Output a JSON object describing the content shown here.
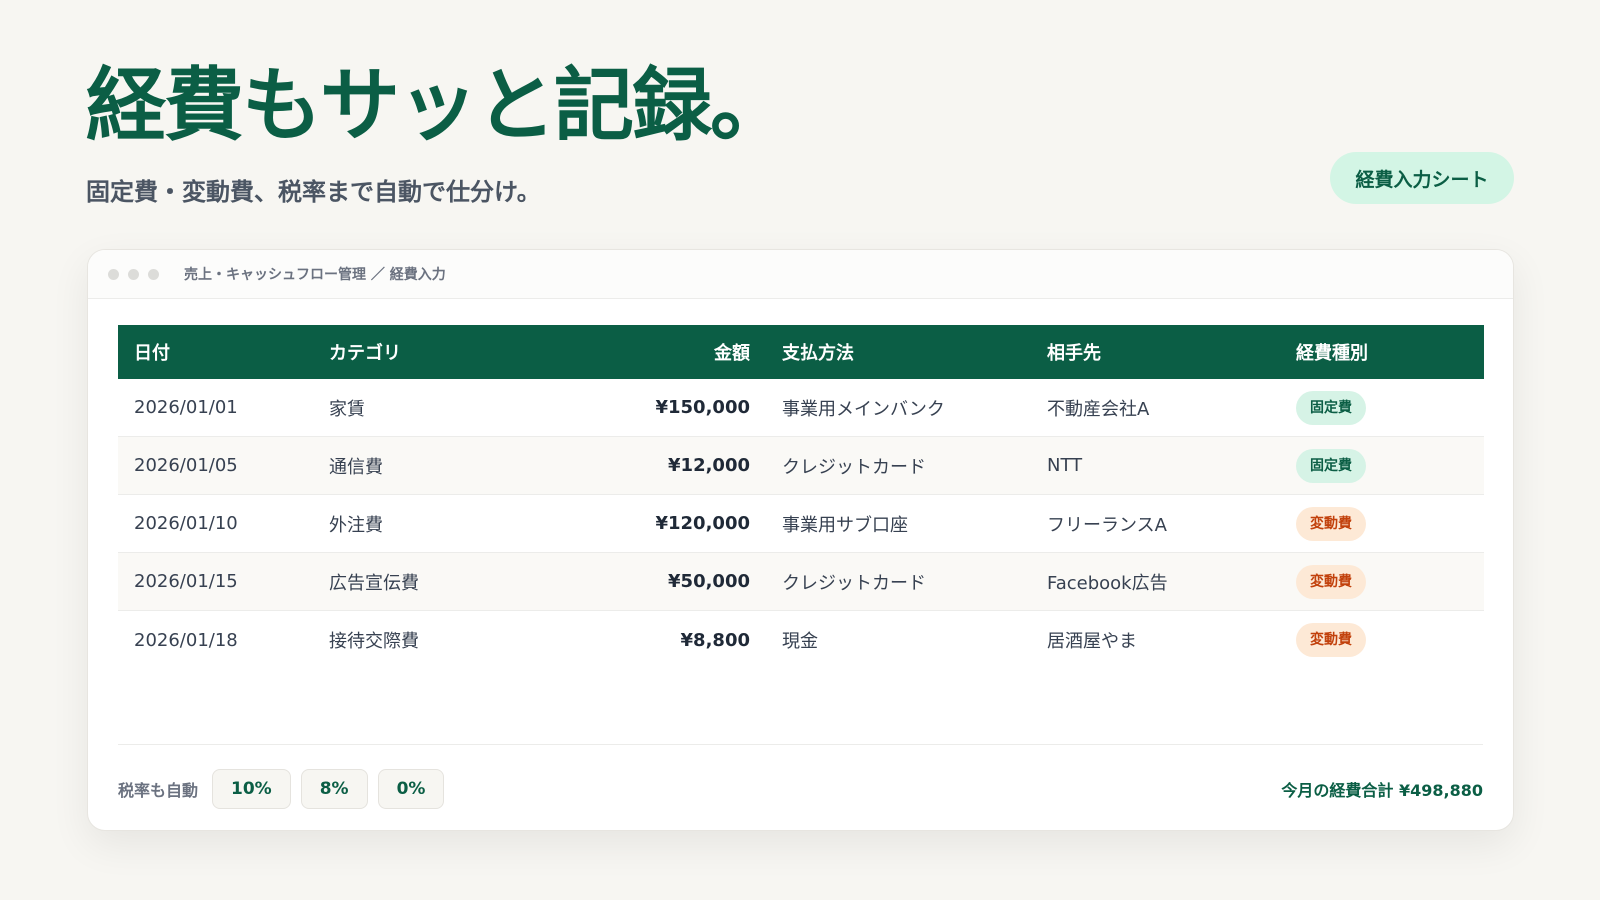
{
  "hero": {
    "title": "経費もサッと記録。",
    "subtitle": "固定費・変動費、税率まで自動で仕分け。",
    "sheet_label": "経費入力シート"
  },
  "window": {
    "breadcrumb": "売上・キャッシュフロー管理 ／ 経費入力"
  },
  "table": {
    "headers": [
      "日付",
      "カテゴリ",
      "金額",
      "支払方法",
      "相手先",
      "経費種別"
    ],
    "rows": [
      {
        "date": "2026/01/01",
        "category": "家賃",
        "amount": "¥150,000",
        "method": "事業用メインバンク",
        "payee": "不動産会社A",
        "type": "固定費",
        "type_kind": "fixed"
      },
      {
        "date": "2026/01/05",
        "category": "通信費",
        "amount": "¥12,000",
        "method": "クレジットカード",
        "payee": "NTT",
        "type": "固定費",
        "type_kind": "fixed"
      },
      {
        "date": "2026/01/10",
        "category": "外注費",
        "amount": "¥120,000",
        "method": "事業用サブ口座",
        "payee": "フリーランスA",
        "type": "変動費",
        "type_kind": "variable"
      },
      {
        "date": "2026/01/15",
        "category": "広告宣伝費",
        "amount": "¥50,000",
        "method": "クレジットカード",
        "payee": "Facebook広告",
        "type": "変動費",
        "type_kind": "variable"
      },
      {
        "date": "2026/01/18",
        "category": "接待交際費",
        "amount": "¥8,800",
        "method": "現金",
        "payee": "居酒屋やま",
        "type": "変動費",
        "type_kind": "variable"
      }
    ]
  },
  "footer": {
    "tax_label": "税率も自動",
    "tax_rates": [
      "10%",
      "8%",
      "0%"
    ],
    "total_label": "今月の経費合計 ¥498,880"
  },
  "colors": {
    "brand": "#0b5e45",
    "fixed_badge_bg": "#d6f3e6",
    "variable_badge_bg": "#fde9d6",
    "variable_badge_text": "#c2410c",
    "background": "#f7f6f2"
  }
}
